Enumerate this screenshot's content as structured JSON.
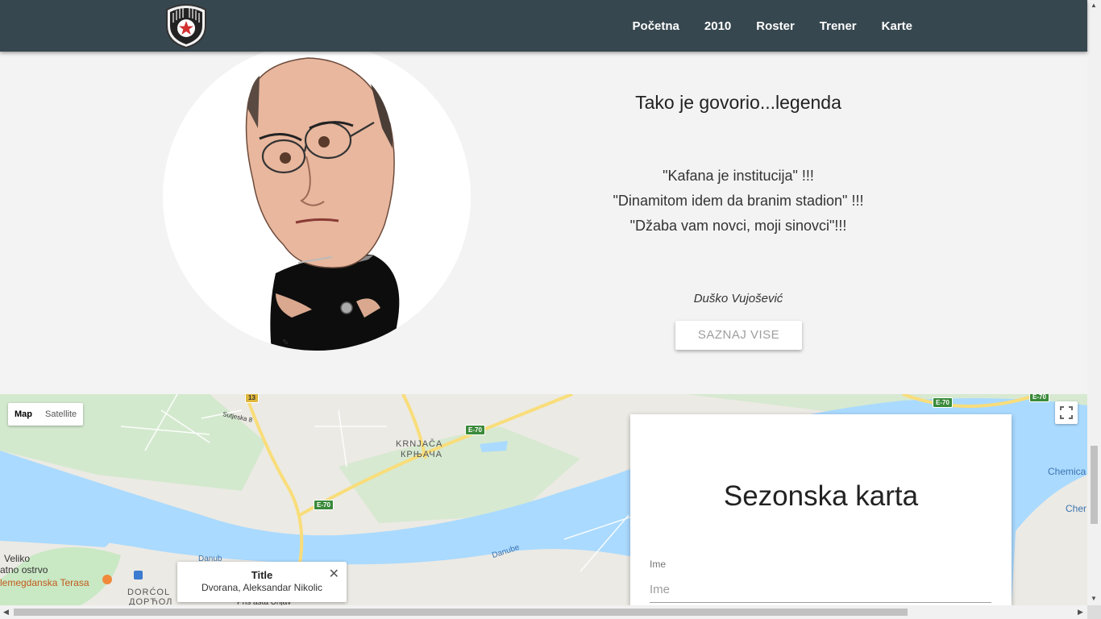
{
  "navbar": {
    "links": [
      "Početna",
      "2010",
      "Roster",
      "Trener",
      "Karte"
    ]
  },
  "legend": {
    "title": "Tako je govorio...legenda",
    "quotes": [
      "\"Kafana je institucija\" !!!",
      "\"Dinamitom idem da branim stadion\" !!!",
      "\"Džaba vam novci, moji sinovci\"!!!"
    ],
    "author": "Duško Vujošević",
    "button": "SAZNAJ VISE"
  },
  "map": {
    "type_controls": [
      "Map",
      "Satellite"
    ],
    "info_window": {
      "title": "Title",
      "body": "Dvorana, Aleksandar Nikolic"
    },
    "labels": {
      "krnjaca": "KRNJAČA",
      "krnjaca_cyr": "КРЊАЧА",
      "veliko": "Veliko",
      "ostrvo": "atno ostrvo",
      "terasa": "lemegdanska Terasa",
      "dorcol": "DORĆOL",
      "dorcol_cyr": "ДОРЋОЛ",
      "danube1": "Danube",
      "danube2": "Danub",
      "sutjeska": "Sutjeska 8",
      "chemica1": "Chemica",
      "chemica2": "Cher",
      "street": "Pris  asta Unjav"
    },
    "shields": {
      "r13": "13",
      "e70a": "E-70",
      "e70b": "E-70",
      "e70c": "E-70",
      "e70d": "E-70"
    }
  },
  "ticket": {
    "title": "Sezonska karta",
    "field_label": "Ime",
    "field_placeholder": "Ime"
  },
  "colors": {
    "navbar": "#37474f",
    "water": "#aadaff",
    "road": "#f9dd7a",
    "park": "#c9e8c4"
  }
}
